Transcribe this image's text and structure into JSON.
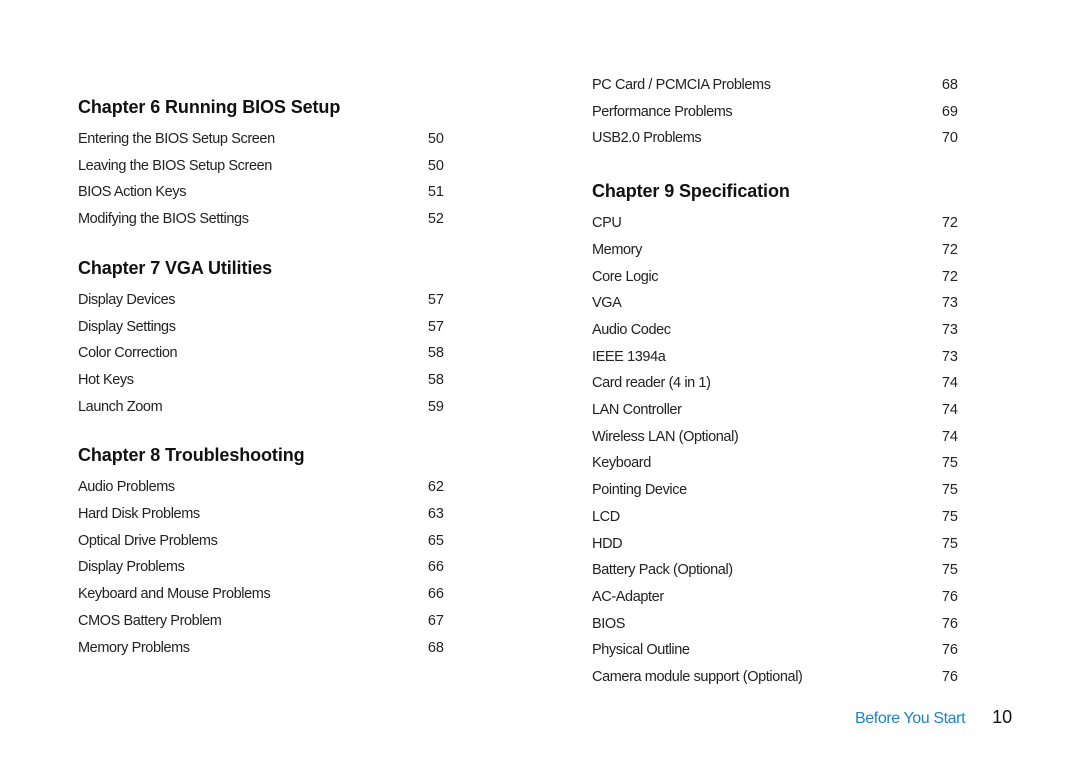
{
  "left_column": {
    "chapters": [
      {
        "title": "Chapter 6  Running BIOS Setup",
        "entries": [
          {
            "label": "Entering the BIOS Setup Screen",
            "page": "50"
          },
          {
            "label": "Leaving the BIOS Setup Screen",
            "page": "50"
          },
          {
            "label": "BIOS Action Keys",
            "page": "51"
          },
          {
            "label": "Modifying the BIOS Settings",
            "page": "52"
          }
        ]
      },
      {
        "title": "Chapter 7  VGA Utilities",
        "entries": [
          {
            "label": "Display Devices",
            "page": "57"
          },
          {
            "label": "Display Settings",
            "page": "57"
          },
          {
            "label": "Color Correction",
            "page": "58"
          },
          {
            "label": "Hot Keys",
            "page": "58"
          },
          {
            "label": "Launch Zoom",
            "page": "59"
          }
        ]
      },
      {
        "title": "Chapter 8  Troubleshooting",
        "entries": [
          {
            "label": "Audio Problems",
            "page": "62"
          },
          {
            "label": "Hard Disk Problems",
            "page": "63"
          },
          {
            "label": "Optical Drive Problems",
            "page": "65"
          },
          {
            "label": "Display Problems",
            "page": "66"
          },
          {
            "label": "Keyboard and Mouse Problems",
            "page": "66"
          },
          {
            "label": "CMOS Battery Problem",
            "page": "67"
          },
          {
            "label": "Memory Problems",
            "page": "68"
          }
        ]
      }
    ]
  },
  "right_column": {
    "continued_entries": [
      {
        "label": "PC Card / PCMCIA Problems",
        "page": "68"
      },
      {
        "label": "Performance Problems",
        "page": "69"
      },
      {
        "label": "USB2.0 Problems",
        "page": "70"
      }
    ],
    "chapter": {
      "title": "Chapter 9  Specification",
      "entries": [
        {
          "label": "CPU",
          "page": "72"
        },
        {
          "label": "Memory",
          "page": "72"
        },
        {
          "label": "Core Logic",
          "page": "72"
        },
        {
          "label": "VGA",
          "page": "73"
        },
        {
          "label": "Audio Codec",
          "page": "73"
        },
        {
          "label": "IEEE 1394a",
          "page": "73"
        },
        {
          "label": "Card reader (4 in 1)",
          "page": "74"
        },
        {
          "label": "LAN Controller",
          "page": "74"
        },
        {
          "label": "Wireless LAN (Optional)",
          "page": "74"
        },
        {
          "label": "Keyboard",
          "page": "75"
        },
        {
          "label": "Pointing Device",
          "page": "75"
        },
        {
          "label": "LCD",
          "page": "75"
        },
        {
          "label": "HDD",
          "page": "75"
        },
        {
          "label": "Battery Pack (Optional)",
          "page": "75"
        },
        {
          "label": "AC-Adapter",
          "page": "76"
        },
        {
          "label": "BIOS",
          "page": "76"
        },
        {
          "label": "Physical Outline",
          "page": "76"
        },
        {
          "label": "Camera module support (Optional)",
          "page": "76"
        }
      ]
    }
  },
  "footer": {
    "section": "Before You Start",
    "page_number": "10",
    "section_color": "#1a85c8"
  }
}
